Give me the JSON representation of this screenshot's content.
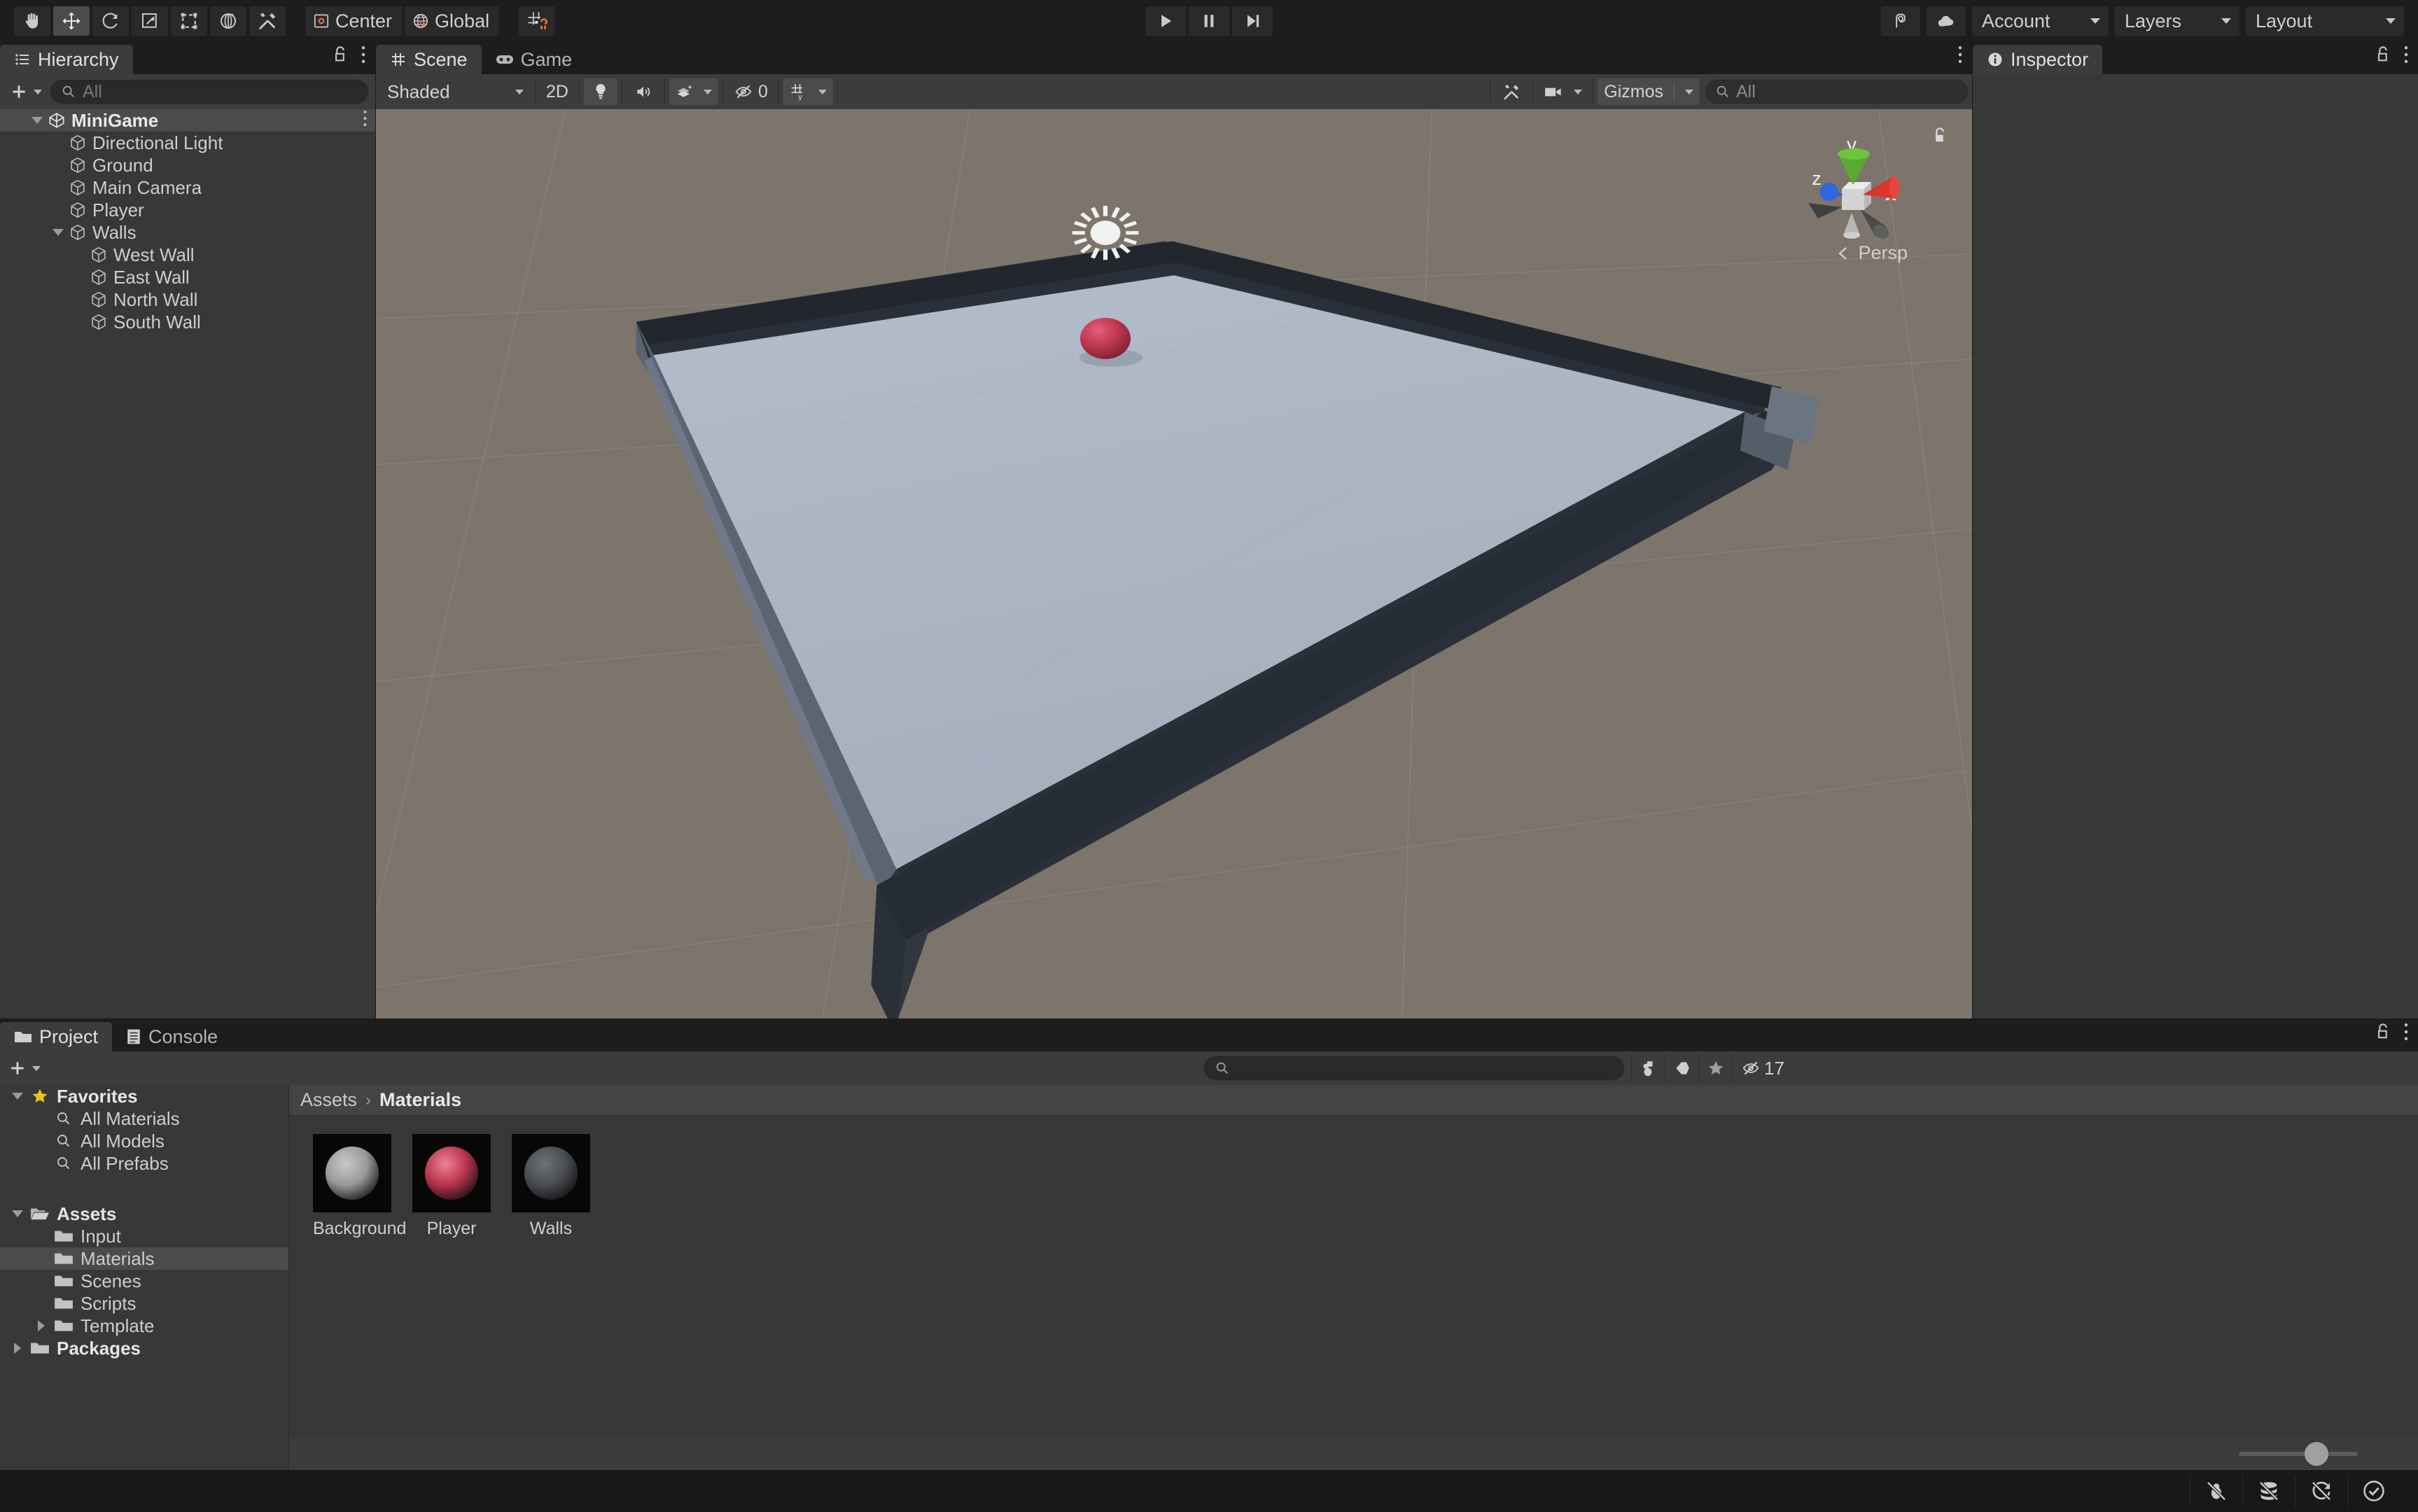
{
  "toolbar": {
    "tools": [
      {
        "name": "hand-tool",
        "label": "Hand",
        "active": false
      },
      {
        "name": "move-tool",
        "label": "Move",
        "active": true
      },
      {
        "name": "rotate-tool",
        "label": "Rotate",
        "active": false
      },
      {
        "name": "scale-tool",
        "label": "Scale",
        "active": false
      },
      {
        "name": "rect-tool",
        "label": "Rect Transform",
        "active": false
      },
      {
        "name": "transform-tool",
        "label": "Transform",
        "active": false
      },
      {
        "name": "custom-tool",
        "label": "Custom Editor Tool",
        "active": false
      }
    ],
    "pivot_label": "Center",
    "handle_label": "Global",
    "snap_label": "Grid Snapping",
    "play_label": "Play",
    "pause_label": "Pause",
    "step_label": "Step",
    "collab_label": "Collab",
    "cloud_label": "Cloud Services",
    "account_label": "Account",
    "layers_label": "Layers",
    "layout_label": "Layout"
  },
  "hierarchy": {
    "tab_label": "Hierarchy",
    "add_label": "+",
    "search_placeholder": "All",
    "search_value": "",
    "items": [
      {
        "label": "MiniGame",
        "depth": 0,
        "kind": "scene",
        "expanded": true,
        "selected": true,
        "kebab": true
      },
      {
        "label": "Directional Light",
        "depth": 1,
        "kind": "object",
        "expanded": null,
        "selected": false,
        "kebab": false
      },
      {
        "label": "Ground",
        "depth": 1,
        "kind": "object",
        "expanded": null,
        "selected": false,
        "kebab": false
      },
      {
        "label": "Main Camera",
        "depth": 1,
        "kind": "object",
        "expanded": null,
        "selected": false,
        "kebab": false
      },
      {
        "label": "Player",
        "depth": 1,
        "kind": "object",
        "expanded": null,
        "selected": false,
        "kebab": false
      },
      {
        "label": "Walls",
        "depth": 1,
        "kind": "object",
        "expanded": true,
        "selected": false,
        "kebab": false
      },
      {
        "label": "West Wall",
        "depth": 2,
        "kind": "object",
        "expanded": null,
        "selected": false,
        "kebab": false
      },
      {
        "label": "East Wall",
        "depth": 2,
        "kind": "object",
        "expanded": null,
        "selected": false,
        "kebab": false
      },
      {
        "label": "North Wall",
        "depth": 2,
        "kind": "object",
        "expanded": null,
        "selected": false,
        "kebab": false
      },
      {
        "label": "South Wall",
        "depth": 2,
        "kind": "object",
        "expanded": null,
        "selected": false,
        "kebab": false
      }
    ]
  },
  "scene": {
    "tabs": [
      {
        "label": "Scene",
        "active": true
      },
      {
        "label": "Game",
        "active": false
      }
    ],
    "draw_mode": "Shaded",
    "mode_2d_label": "2D",
    "lighting_label": "Lighting",
    "audio_label": "Audio",
    "fx_label": "Effects",
    "hidden_count": "0",
    "grid_label": "Grid",
    "tools_label": "Scene Tools",
    "camera_label": "Camera",
    "gizmos_label": "Gizmos",
    "search_placeholder": "All",
    "search_value": "",
    "projection_label": "Persp",
    "axis_x": "x",
    "axis_y": "y",
    "axis_z": "z",
    "colors": {
      "background": "#7d746c",
      "ground": "#aab4c4",
      "wall_top": "#22272e",
      "wall_side": "#6e7683",
      "player": "#c33a53"
    }
  },
  "inspector": {
    "tab_label": "Inspector"
  },
  "project": {
    "tabs": [
      {
        "label": "Project",
        "active": true
      },
      {
        "label": "Console",
        "active": false
      }
    ],
    "add_label": "+",
    "search_placeholder": "",
    "search_value": "",
    "hidden_count": "17",
    "breadcrumb": [
      "Assets",
      "Materials"
    ],
    "tree": [
      {
        "label": "Favorites",
        "depth": 0,
        "icon": "star",
        "expanded": true,
        "bold": true,
        "selected": false
      },
      {
        "label": "All Materials",
        "depth": 1,
        "icon": "search",
        "expanded": null,
        "bold": false,
        "selected": false
      },
      {
        "label": "All Models",
        "depth": 1,
        "icon": "search",
        "expanded": null,
        "bold": false,
        "selected": false
      },
      {
        "label": "All Prefabs",
        "depth": 1,
        "icon": "search",
        "expanded": null,
        "bold": false,
        "selected": false
      },
      {
        "label": "",
        "depth": 0,
        "icon": "spacer",
        "expanded": null,
        "bold": false,
        "selected": false
      },
      {
        "label": "Assets",
        "depth": 0,
        "icon": "folderopen",
        "expanded": true,
        "bold": true,
        "selected": false
      },
      {
        "label": "Input",
        "depth": 1,
        "icon": "folder",
        "expanded": null,
        "bold": false,
        "selected": false
      },
      {
        "label": "Materials",
        "depth": 1,
        "icon": "folder",
        "expanded": null,
        "bold": false,
        "selected": true
      },
      {
        "label": "Scenes",
        "depth": 1,
        "icon": "folder",
        "expanded": null,
        "bold": false,
        "selected": false
      },
      {
        "label": "Scripts",
        "depth": 1,
        "icon": "folder",
        "expanded": null,
        "bold": false,
        "selected": false
      },
      {
        "label": "Template",
        "depth": 1,
        "icon": "folder",
        "expanded": false,
        "bold": false,
        "selected": false
      },
      {
        "label": "Packages",
        "depth": 0,
        "icon": "folder",
        "expanded": false,
        "bold": true,
        "selected": false
      }
    ],
    "assets": [
      {
        "name": "Background",
        "color": "#9a9a9a",
        "highlight": "#c8c8c8"
      },
      {
        "name": "Player",
        "color": "#b8344c",
        "highlight": "#ef8298"
      },
      {
        "name": "Walls",
        "color": "#4a4d52",
        "highlight": "#6e7176"
      }
    ],
    "zoom_percent": "55"
  },
  "statusbar": {
    "items": [
      {
        "name": "debug-off-icon",
        "label": "Debugger Disabled"
      },
      {
        "name": "cache-off-icon",
        "label": "Cache Server Disabled"
      },
      {
        "name": "autorefresh-off-icon",
        "label": "Auto Refresh Off"
      },
      {
        "name": "ok-icon",
        "label": "OK"
      }
    ]
  }
}
